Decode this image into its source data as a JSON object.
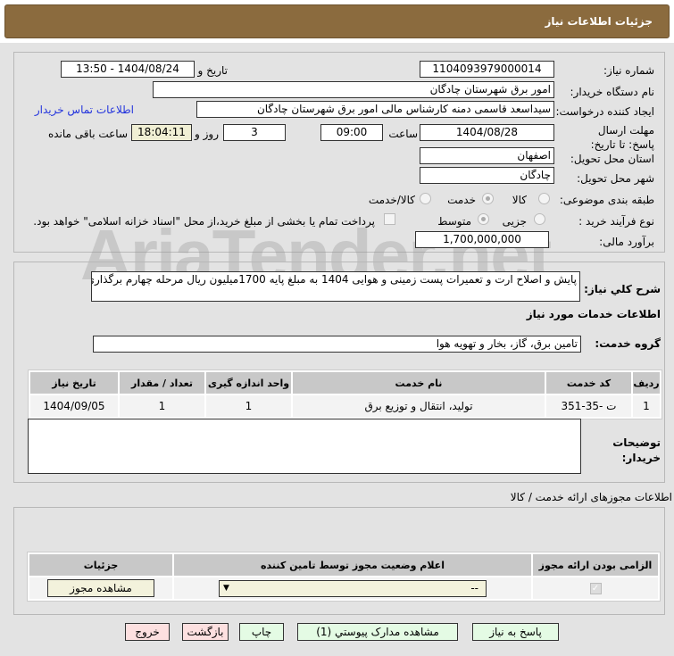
{
  "header": {
    "title": "جزئیات اطلاعات نیاز"
  },
  "form": {
    "need_number_label": "شماره نیاز:",
    "need_number": "1104093979000014",
    "announce_label": "تاریخ و ساعت اعلان عمومی:",
    "announce_value": "1404/08/24 - 13:50",
    "buyer_org_label": "نام دستگاه خریدار:",
    "buyer_org": "امور برق شهرستان چادگان",
    "creator_label": "ایجاد کننده درخواست:",
    "creator": "سیداسعد قاسمی دمنه کارشناس مالی امور برق شهرستان چادگان",
    "contact_link": "اطلاعات تماس خریدار",
    "deadline_label": "مهلت ارسال پاسخ: تا تاریخ:",
    "deadline_date": "1404/08/28",
    "time_label": "ساعت",
    "deadline_time": "09:00",
    "days": "3",
    "days_label": "روز و",
    "remaining": "18:04:11",
    "remaining_label": "ساعت باقی مانده",
    "province_label": "استان محل تحویل:",
    "province": "اصفهان",
    "city_label": "شهر محل تحویل:",
    "city": "چادگان",
    "category_label": "طبقه بندی موضوعی:",
    "category_options": [
      "کالا",
      "خدمت",
      "کالا/خدمت"
    ],
    "category_selected": "خدمت",
    "process_label": "نوع فرآیند خرید :",
    "process_options": [
      "جزیی",
      "متوسط"
    ],
    "process_selected": "متوسط",
    "treasury_checked": false,
    "payment_note": "پرداخت تمام یا بخشی از مبلغ خرید،از محل \"اسناد خزانه اسلامی\" خواهد بود.",
    "budget_label": "برآورد مالی:",
    "budget": "1,700,000,000"
  },
  "desc": {
    "label": "شرح کلي نیاز:",
    "value": "پایش و اصلاح ارت و تعمیرات پست زمینی و هوایی 1404 به مبلغ پایه 1700میلیون ریال  مرحله چهارم برگذاری"
  },
  "services": {
    "title": "اطلاعات خدمات مورد نیاز",
    "group_label": "گروه خدمت:",
    "group": "تامین برق، گاز، بخار و تهویه هوا",
    "columns": [
      "ردیف",
      "کد خدمت",
      "نام خدمت",
      "واحد اندازه گیری",
      "تعداد / مقدار",
      "تاریخ نیاز"
    ],
    "rows": [
      [
        "1",
        "ت -35-351",
        "تولید، انتقال و توزیع برق",
        "1",
        "1",
        "1404/09/05"
      ]
    ],
    "notes_label": "توضیحات خریدار:"
  },
  "permits": {
    "title": "اطلاعات مجوزهای ارائه خدمت / کالا",
    "columns": [
      "الزامی بودن ارائه مجوز",
      "اعلام وضعیت مجوز توسط تامین کننده",
      "جزئیات"
    ],
    "required_checked": true,
    "select_value": "--",
    "view_button": "مشاهده مجوز"
  },
  "buttons": {
    "reply": "پاسخ به نیاز",
    "attachments": "مشاهده مدارک پیوستي (1)",
    "print": "چاپ",
    "back": "بازگشت",
    "exit": "خروج"
  },
  "watermark": "AriaTender.net"
}
